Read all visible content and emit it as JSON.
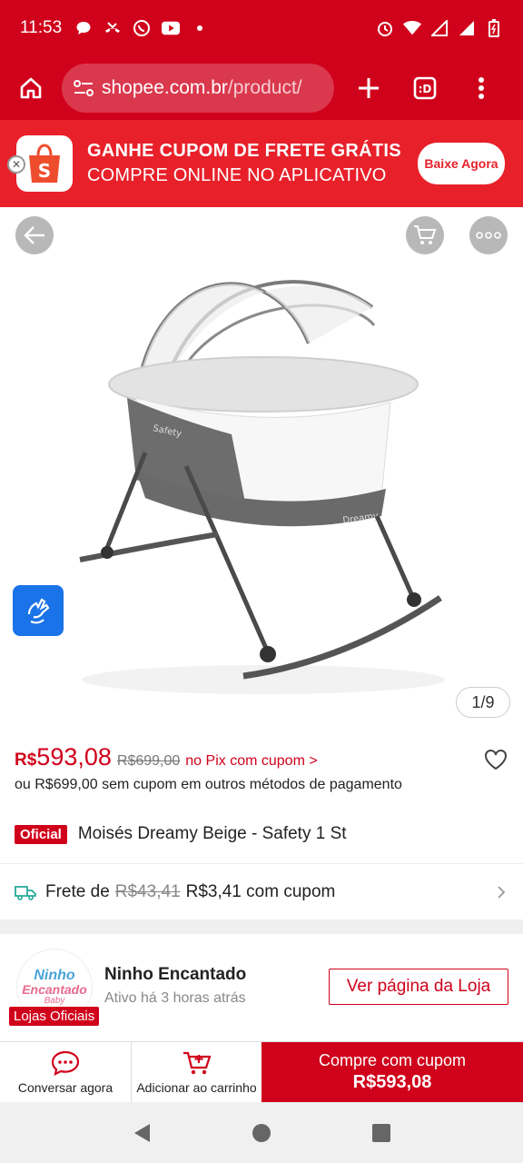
{
  "status_bar": {
    "time": "11:53"
  },
  "browser": {
    "url_domain": "shopee.com.br",
    "url_path": "/product/"
  },
  "banner": {
    "line1": "GANHE CUPOM DE FRETE GRÁTIS",
    "line2": "COMPRE ONLINE NO APLICATIVO",
    "button": "Baixe Agora"
  },
  "gallery": {
    "counter": "1/9"
  },
  "product": {
    "currency": "R$",
    "price": "593,08",
    "old_price": "R$699,00",
    "pix_note": "no Pix com cupom >",
    "alt_price": "ou R$699,00 sem cupom em outros métodos de pagamento",
    "badge": "Oficial",
    "title": "Moisés Dreamy Beige - Safety 1 St"
  },
  "shipping": {
    "label": "Frete de",
    "old": "R$43,41",
    "new": "R$3,41 com cupom"
  },
  "store": {
    "logo_line1": "Ninho",
    "logo_line2": "Encantado",
    "logo_line3": "Baby",
    "badge": "Lojas Oficiais",
    "name": "Ninho Encantado",
    "active": "Ativo há 3 horas atrás",
    "button": "Ver página da Loja"
  },
  "bottom_bar": {
    "chat": "Conversar agora",
    "cart": "Adicionar ao carrinho",
    "buy_line1": "Compre com cupom",
    "buy_line2": "R$593,08"
  },
  "colors": {
    "brand_red": "#d0011b",
    "banner_red": "#e8202a"
  }
}
